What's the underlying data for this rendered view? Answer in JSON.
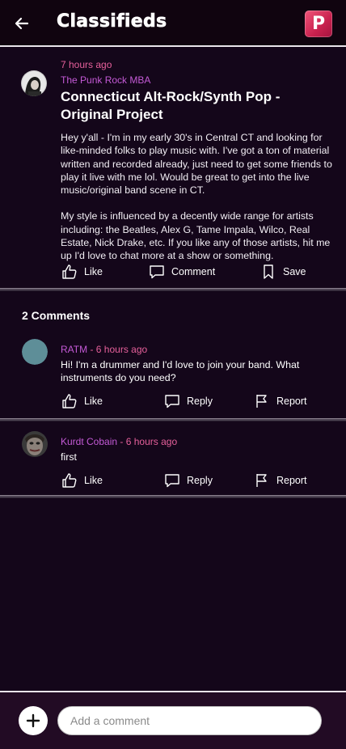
{
  "header": {
    "title": "Classifieds",
    "logo_letter": "P",
    "back_icon": "arrow-left-icon"
  },
  "colors": {
    "background": "#14061a",
    "time": "#e6609b",
    "author": "#c45ad6",
    "logo": "#c8214e"
  },
  "post": {
    "time": "7 hours ago",
    "author": "The Punk Rock MBA",
    "title": "Connecticut Alt-Rock/Synth Pop - Original Project",
    "body": [
      "Hey y'all - I'm in my early 30's in Central CT and looking for like-minded folks to play music with. I've got a ton of material written and recorded already, just need to get some friends to play it live with me lol. Would be great to get into the live music/original band scene in CT.",
      "My style is influenced by a decently wide range for artists including: the Beatles, Alex G, Tame Impala, Wilco, Real Estate, Nick Drake, etc. If you like any of those artists, hit me up I'd love to chat more at a show or something."
    ],
    "actions": {
      "like": "Like",
      "comment": "Comment",
      "save": "Save"
    }
  },
  "comments_header": "2 Comments",
  "comments": [
    {
      "author": "RATM",
      "separator": "-",
      "time": "6 hours ago",
      "text": "Hi! I'm a drummer and I'd love to join your band. What instruments do you need?",
      "actions": {
        "like": "Like",
        "reply": "Reply",
        "report": "Report"
      }
    },
    {
      "author": "Kurdt Cobain",
      "separator": "-",
      "time": "6 hours ago",
      "text": "first",
      "actions": {
        "like": "Like",
        "reply": "Reply",
        "report": "Report"
      }
    }
  ],
  "footer": {
    "input_placeholder": "Add a comment",
    "add_icon": "plus-icon"
  }
}
